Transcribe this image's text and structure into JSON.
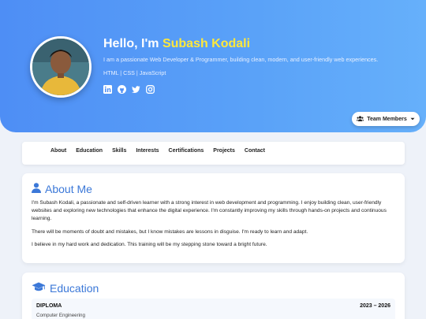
{
  "colors": {
    "accent": "#3b78d8",
    "hero_start": "#4e8ef5",
    "hero_end": "#66b0fb",
    "name_highlight": "#ffe83c"
  },
  "hero": {
    "greeting": "Hello, I'm",
    "name": "Subash Kodali",
    "subtitle": "I am a passionate Web Developer & Programmer, building clean, modern, and user-friendly web experiences.",
    "tech": "HTML | CSS | JavaScript",
    "social_icons": [
      "linkedin-icon",
      "github-icon",
      "twitter-icon",
      "instagram-icon"
    ]
  },
  "team_button": {
    "label": "Team Members",
    "icon": "users-icon",
    "caret": "caret-down-icon"
  },
  "nav": {
    "items": [
      "About",
      "Education",
      "Skills",
      "Interests",
      "Certifications",
      "Projects",
      "Contact"
    ]
  },
  "about": {
    "title": "About Me",
    "icon": "user-icon",
    "paragraphs": [
      "I'm Subash Kodali, a passionate and self-driven learner with a strong interest in web development and programming. I enjoy building clean, user-friendly websites and exploring new technologies that enhance the digital experience. I'm constantly improving my skills through hands-on projects and continuous learning.",
      "There will be moments of doubt and mistakes, but I know mistakes are lessons in disguise. I'm ready to learn and adapt.",
      "I believe in my hard work and dedication. This training will be my stepping stone toward a bright future."
    ]
  },
  "education": {
    "title": "Education",
    "icon": "graduation-cap-icon",
    "items": [
      {
        "degree": "DIPLOMA",
        "field": "Computer Engineering",
        "years": "2023 – 2026"
      }
    ]
  }
}
